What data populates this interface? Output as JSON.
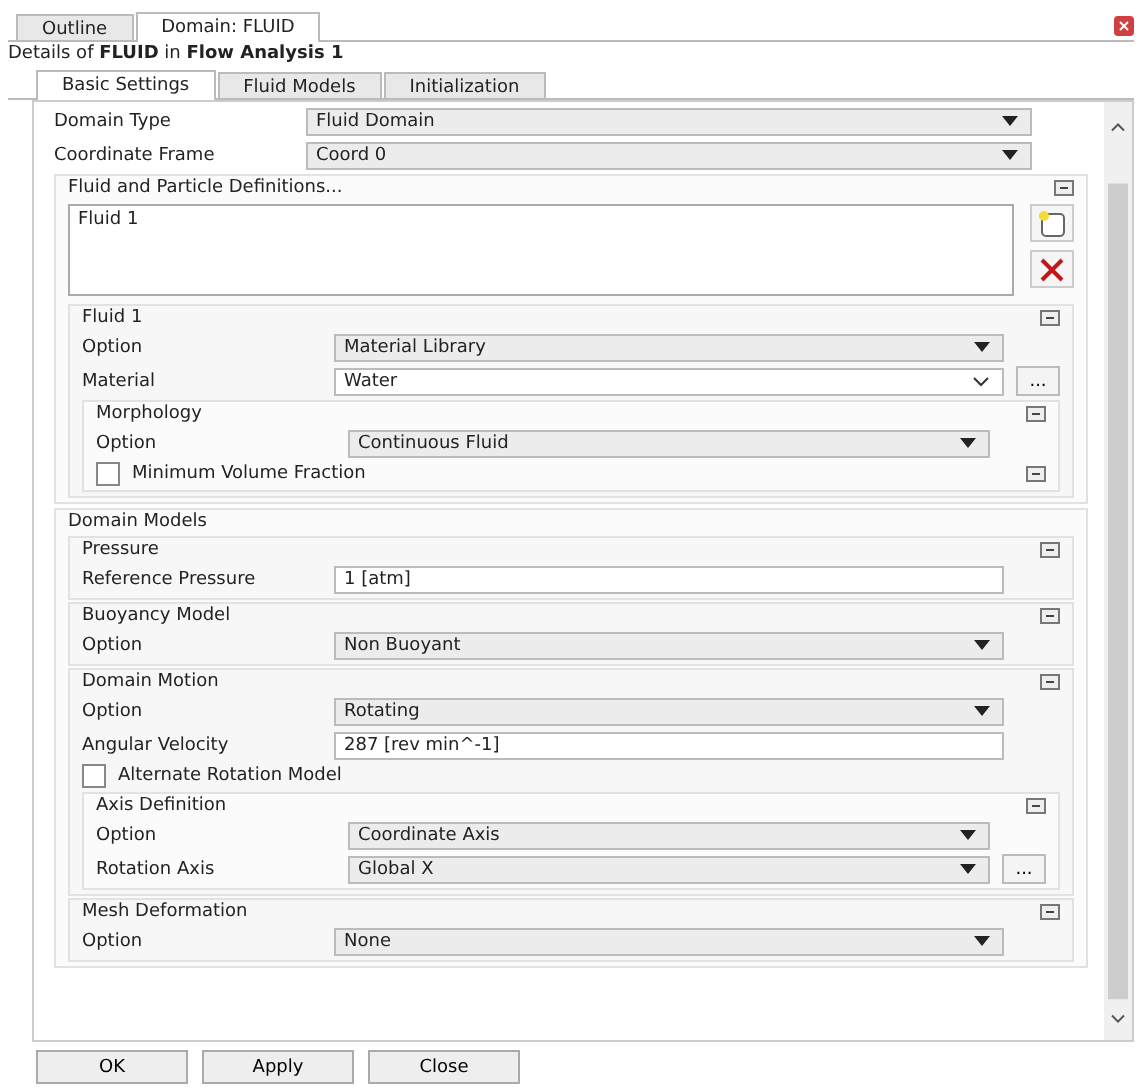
{
  "outer_tabs": [
    {
      "label": "Outline",
      "selected": false
    },
    {
      "label": "Domain: FLUID",
      "selected": true
    }
  ],
  "details_title": "Details of **FLUID** in **Flow Analysis 1**",
  "inner_tabs": [
    {
      "label": "Basic Settings",
      "selected": true
    },
    {
      "label": "Fluid Models",
      "selected": false
    },
    {
      "label": "Initialization",
      "selected": false
    }
  ],
  "items": [
    {
      "kind": "dropdown",
      "label": "Domain Type",
      "value": "Fluid Domain"
    },
    {
      "kind": "dropdown",
      "label": "Coordinate Frame",
      "value": "Coord 0"
    },
    {
      "kind": "group",
      "title": "Fluid and Particle Definitions...",
      "collapsible": true,
      "children": [
        {
          "kind": "list",
          "entries": [
            "Fluid 1"
          ]
        },
        {
          "kind": "group",
          "title": "Fluid 1",
          "collapsible": true,
          "children": [
            {
              "kind": "dropdown",
              "label": "Option",
              "value": "Material Library"
            },
            {
              "kind": "combo",
              "label": "Material",
              "value": "Water",
              "browse_label": "..."
            },
            {
              "kind": "group",
              "title": "Morphology",
              "collapsible": true,
              "children": [
                {
                  "kind": "dropdown",
                  "label": "Option",
                  "value": "Continuous Fluid"
                },
                {
                  "kind": "checkbox",
                  "label": "Minimum Volume Fraction",
                  "checked": false,
                  "collapsible": true
                }
              ]
            }
          ]
        }
      ]
    },
    {
      "kind": "group",
      "title": "Domain Models",
      "collapsible": false,
      "children": [
        {
          "kind": "group",
          "title": "Pressure",
          "collapsible": true,
          "children": [
            {
              "kind": "input",
              "label": "Reference Pressure",
              "value": "1 [atm]"
            }
          ]
        },
        {
          "kind": "group",
          "title": "Buoyancy Model",
          "collapsible": true,
          "children": [
            {
              "kind": "dropdown",
              "label": "Option",
              "value": "Non Buoyant"
            }
          ]
        },
        {
          "kind": "group",
          "title": "Domain Motion",
          "collapsible": true,
          "children": [
            {
              "kind": "dropdown",
              "label": "Option",
              "value": "Rotating"
            },
            {
              "kind": "input",
              "label": "Angular Velocity",
              "value": "287 [rev min^-1]"
            },
            {
              "kind": "checkbox",
              "label": "Alternate Rotation Model",
              "checked": false,
              "collapsible": false
            },
            {
              "kind": "group",
              "title": "Axis Definition",
              "collapsible": true,
              "children": [
                {
                  "kind": "dropdown",
                  "label": "Option",
                  "value": "Coordinate Axis"
                },
                {
                  "kind": "dropdown",
                  "label": "Rotation Axis",
                  "value": "Global X",
                  "browse_label": "..."
                }
              ]
            }
          ]
        },
        {
          "kind": "group",
          "title": "Mesh Deformation",
          "collapsible": true,
          "children": [
            {
              "kind": "dropdown",
              "label": "Option",
              "value": "None"
            }
          ]
        }
      ]
    }
  ],
  "buttons": [
    "OK",
    "Apply",
    "Close"
  ]
}
